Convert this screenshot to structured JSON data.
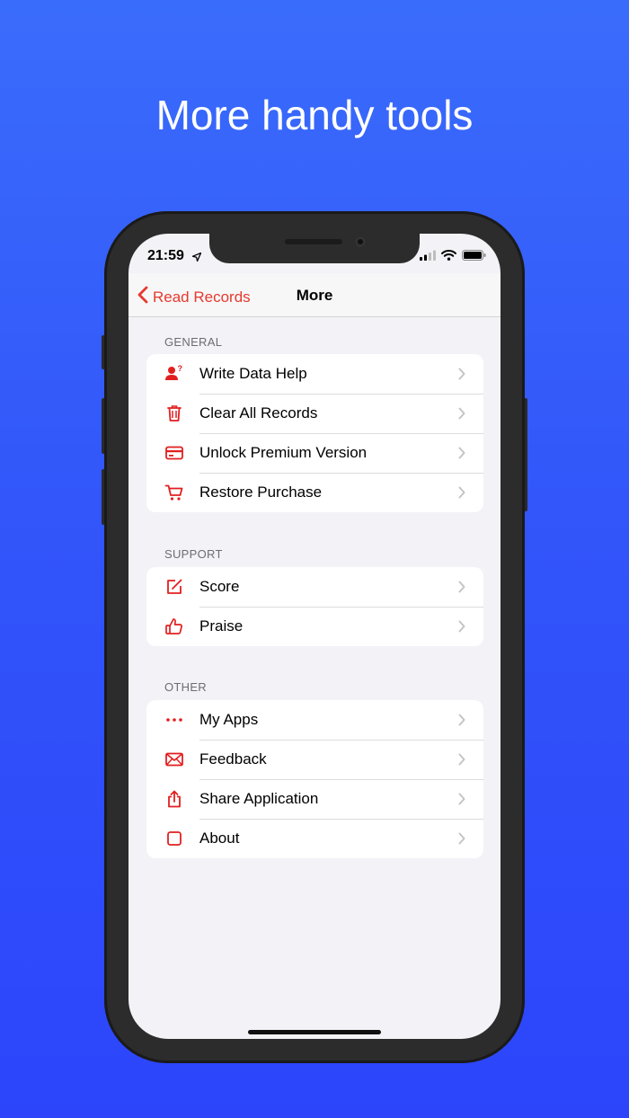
{
  "headline": "More handy tools",
  "status_bar": {
    "time": "21:59"
  },
  "nav": {
    "back_label": "Read Records",
    "title": "More"
  },
  "sections": [
    {
      "header": "GENERAL",
      "items": [
        {
          "label": "Write Data Help",
          "icon": "person-question-icon"
        },
        {
          "label": "Clear All Records",
          "icon": "trash-icon"
        },
        {
          "label": "Unlock Premium Version",
          "icon": "credit-card-icon"
        },
        {
          "label": "Restore Purchase",
          "icon": "cart-icon"
        }
      ]
    },
    {
      "header": "SUPPORT",
      "items": [
        {
          "label": "Score",
          "icon": "edit-square-icon"
        },
        {
          "label": "Praise",
          "icon": "thumbs-up-icon"
        }
      ]
    },
    {
      "header": "OTHER",
      "items": [
        {
          "label": "My Apps",
          "icon": "ellipsis-icon"
        },
        {
          "label": "Feedback",
          "icon": "envelope-icon"
        },
        {
          "label": "Share Application",
          "icon": "share-icon"
        },
        {
          "label": "About",
          "icon": "square-icon"
        }
      ]
    }
  ],
  "colors": {
    "accent": "#e21f1f",
    "back_tint": "#e63a2e",
    "background_top": "#3a6cfb",
    "background_bottom": "#2c45fb"
  }
}
